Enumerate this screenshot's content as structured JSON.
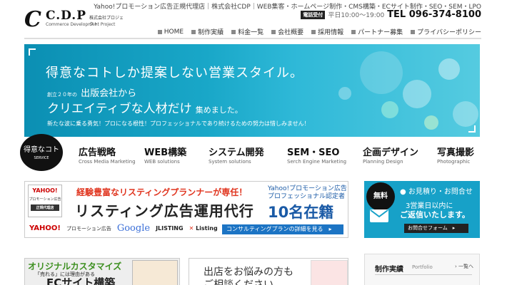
{
  "header": {
    "logo_mark": "C",
    "logo_name": "C.D.P",
    "logo_jp": "株式会社プロジェクト",
    "logo_en": "Commerce Development Project",
    "tagline": "Yahoo!プロモーション広告正規代理店｜株式会社CDP｜WEB集客・ホームページ制作・CMS構築・ECサイト制作・SEO・SEM・LPO",
    "phone_badge": "電話受付",
    "phone_hours": "平日10:00〜19:00",
    "phone_number": "TEL 096-374-8100",
    "nav": [
      {
        "label": "HOME"
      },
      {
        "label": "制作実績"
      },
      {
        "label": "料金一覧"
      },
      {
        "label": "会社概要"
      },
      {
        "label": "採用情報"
      },
      {
        "label": "パートナー募集"
      },
      {
        "label": "プライバシーポリシー"
      }
    ]
  },
  "hero": {
    "headline": "得意なコトしか提案しない営業スタイル。",
    "line2_small": "創立２０年の",
    "line2_main": "出版会社から",
    "line3_main": "クリエイティブな人材だけ",
    "line3_tail": "集めました。",
    "line4": "新たな波に乗る勇気！プロになる根性！プロフェッショナルであり続けるための努力は惜しみません！"
  },
  "services": {
    "badge_label": "得意なコト",
    "badge_sub": "SERVICE",
    "items": [
      {
        "title": "広告戦略",
        "sub": "Cross Media Marketing"
      },
      {
        "title": "WEB構築",
        "sub": "WEB solutions"
      },
      {
        "title": "システム開発",
        "sub": "System solutions"
      },
      {
        "title": "SEM・SEO",
        "sub": "Serch Engine Marketing"
      },
      {
        "title": "企画デザイン",
        "sub": "Planning Design"
      },
      {
        "title": "写真撮影",
        "sub": "Photographic"
      }
    ]
  },
  "listing": {
    "badge_logo": "YAHOO!",
    "badge_text": "プロモーション広告",
    "badge_tag": "正規代理店",
    "red_text": "経験豊富なリスティングプランナーが専任！",
    "main_text": "リスティング広告運用代行",
    "right1": "Yahoo!プロモーション広告",
    "right2": "プロフェッショナル認定者",
    "count": "10名在籍",
    "yahoo": "YAHOO!",
    "yahoo_sub": "プロモーション広告",
    "google": "Google",
    "jlisting": "JLISTING",
    "xlisting": "Listing",
    "cta": "コンサルティングプランの詳細を見る　▸"
  },
  "contact": {
    "free": "無料",
    "title": "お見積り・お問合せ",
    "line1": "3営業日以内に",
    "line2": "ご返信いたします。",
    "button": "お問合せフォーム　▸"
  },
  "bottom": {
    "custom_title": "オリジナルカスタマイズ",
    "custom_sub": "「売れる」には理由がある",
    "custom_big": "ECサイト構築",
    "consult_q1": "出店をお悩みの方も",
    "consult_q2": "ご相談ください。",
    "works_title": "制作実績",
    "works_sub": "Portfolio",
    "works_link": "一覧へ"
  },
  "colors": {
    "brand_blue": "#17a1c8",
    "accent_red": "#e0341e",
    "cta_blue": "#1c74c4"
  }
}
